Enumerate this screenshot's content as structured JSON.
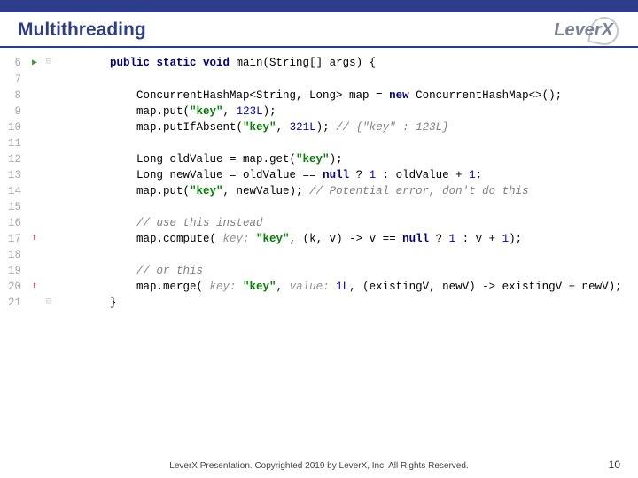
{
  "header": {
    "title": "Multithreading",
    "logo": "LeverX"
  },
  "code": {
    "lines": [
      {
        "num": "6",
        "mark": "play",
        "fold": "open",
        "indent": 2,
        "tokens": [
          {
            "t": "kw",
            "v": "public static void"
          },
          {
            "t": "tx",
            "v": " main(String[] args) {"
          }
        ]
      },
      {
        "num": "7",
        "mark": "",
        "fold": "",
        "indent": 3,
        "tokens": []
      },
      {
        "num": "8",
        "mark": "",
        "fold": "",
        "indent": 3,
        "tokens": [
          {
            "t": "tx",
            "v": "ConcurrentHashMap<String, Long> map = "
          },
          {
            "t": "kw",
            "v": "new"
          },
          {
            "t": "tx",
            "v": " ConcurrentHashMap<>();"
          }
        ]
      },
      {
        "num": "9",
        "mark": "",
        "fold": "",
        "indent": 3,
        "tokens": [
          {
            "t": "tx",
            "v": "map.put("
          },
          {
            "t": "str",
            "v": "\"key\""
          },
          {
            "t": "tx",
            "v": ", "
          },
          {
            "t": "num",
            "v": "123L"
          },
          {
            "t": "tx",
            "v": ");"
          }
        ]
      },
      {
        "num": "10",
        "mark": "",
        "fold": "",
        "indent": 3,
        "tokens": [
          {
            "t": "tx",
            "v": "map.putIfAbsent("
          },
          {
            "t": "str",
            "v": "\"key\""
          },
          {
            "t": "tx",
            "v": ", "
          },
          {
            "t": "num",
            "v": "321L"
          },
          {
            "t": "tx",
            "v": "); "
          },
          {
            "t": "cm",
            "v": "// {\"key\" : 123L}"
          }
        ]
      },
      {
        "num": "11",
        "mark": "",
        "fold": "",
        "indent": 3,
        "tokens": []
      },
      {
        "num": "12",
        "mark": "",
        "fold": "",
        "indent": 3,
        "tokens": [
          {
            "t": "tx",
            "v": "Long oldValue = map.get("
          },
          {
            "t": "str",
            "v": "\"key\""
          },
          {
            "t": "tx",
            "v": ");"
          }
        ]
      },
      {
        "num": "13",
        "mark": "",
        "fold": "",
        "indent": 3,
        "tokens": [
          {
            "t": "tx",
            "v": "Long newValue = oldValue == "
          },
          {
            "t": "kw",
            "v": "null"
          },
          {
            "t": "tx",
            "v": " ? "
          },
          {
            "t": "num",
            "v": "1"
          },
          {
            "t": "tx",
            "v": " : oldValue + "
          },
          {
            "t": "num",
            "v": "1"
          },
          {
            "t": "tx",
            "v": ";"
          }
        ]
      },
      {
        "num": "14",
        "mark": "",
        "fold": "",
        "indent": 3,
        "tokens": [
          {
            "t": "tx",
            "v": "map.put("
          },
          {
            "t": "str",
            "v": "\"key\""
          },
          {
            "t": "tx",
            "v": ", newValue); "
          },
          {
            "t": "cm",
            "v": "// Potential error, don't do this"
          }
        ]
      },
      {
        "num": "15",
        "mark": "",
        "fold": "",
        "indent": 3,
        "tokens": []
      },
      {
        "num": "16",
        "mark": "",
        "fold": "",
        "indent": 3,
        "tokens": [
          {
            "t": "cm",
            "v": "// use this instead"
          }
        ]
      },
      {
        "num": "17",
        "mark": "arrow",
        "fold": "",
        "indent": 3,
        "tokens": [
          {
            "t": "tx",
            "v": "map.compute( "
          },
          {
            "t": "hint",
            "v": "key: "
          },
          {
            "t": "str",
            "v": "\"key\""
          },
          {
            "t": "tx",
            "v": ", (k, v) -> v == "
          },
          {
            "t": "kw",
            "v": "null"
          },
          {
            "t": "tx",
            "v": " ? "
          },
          {
            "t": "num",
            "v": "1"
          },
          {
            "t": "tx",
            "v": " : v + "
          },
          {
            "t": "num",
            "v": "1"
          },
          {
            "t": "tx",
            "v": ");"
          }
        ]
      },
      {
        "num": "18",
        "mark": "",
        "fold": "",
        "indent": 3,
        "tokens": []
      },
      {
        "num": "19",
        "mark": "",
        "fold": "",
        "indent": 3,
        "tokens": [
          {
            "t": "cm",
            "v": "// or this"
          }
        ]
      },
      {
        "num": "20",
        "mark": "arrow",
        "fold": "",
        "indent": 3,
        "tokens": [
          {
            "t": "tx",
            "v": "map.merge( "
          },
          {
            "t": "hint",
            "v": "key: "
          },
          {
            "t": "str",
            "v": "\"key\""
          },
          {
            "t": "tx",
            "v": ", "
          },
          {
            "t": "hint",
            "v": "value: "
          },
          {
            "t": "num",
            "v": "1L"
          },
          {
            "t": "tx",
            "v": ", (existingV, newV) -> existingV + newV);"
          }
        ]
      },
      {
        "num": "21",
        "mark": "",
        "fold": "close",
        "indent": 2,
        "tokens": [
          {
            "t": "tx",
            "v": "}"
          }
        ]
      }
    ]
  },
  "footer": {
    "text": "LeverX Presentation. Copyrighted 2019 by LeverX, Inc. All Rights Reserved.",
    "page": "10"
  }
}
